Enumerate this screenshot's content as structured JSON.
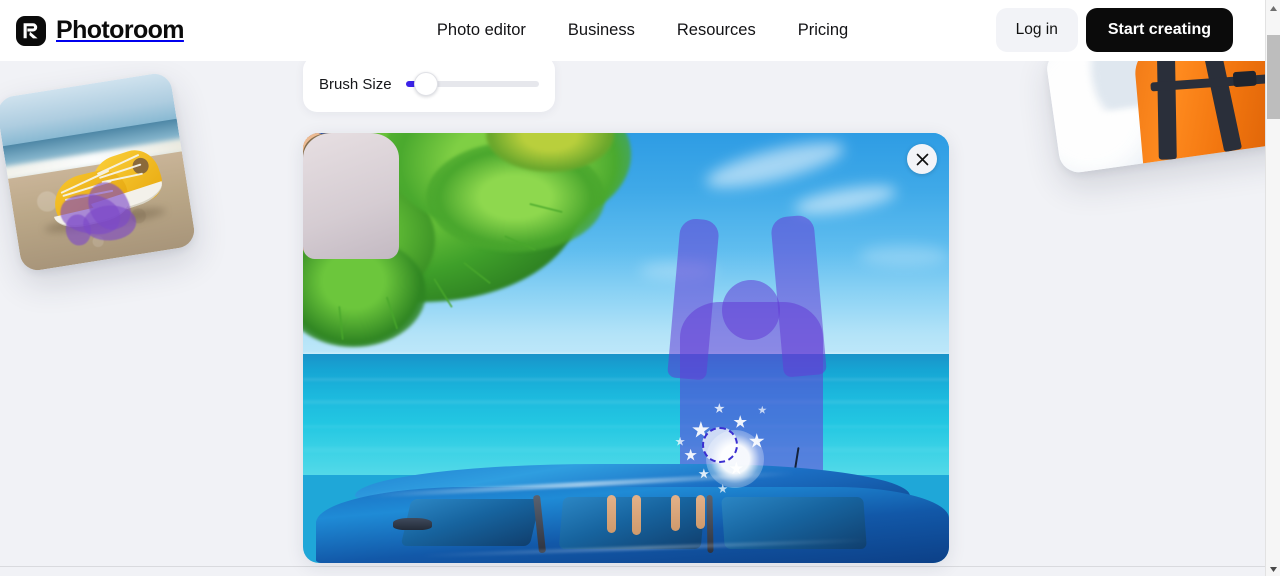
{
  "header": {
    "brand": "Photoroom",
    "logo_icon": "photoroom-r-logo-icon",
    "nav": [
      {
        "label": "Photo editor"
      },
      {
        "label": "Business"
      },
      {
        "label": "Resources"
      },
      {
        "label": "Pricing"
      }
    ],
    "login_label": "Log in",
    "start_label": "Start creating"
  },
  "toolbar": {
    "brush_size_label": "Brush Size",
    "brush_size_value": 8,
    "brush_size_min": 0,
    "brush_size_max": 100,
    "accent_color": "#3b22e8",
    "track_color": "#e6e7ec"
  },
  "editor": {
    "close_icon": "close-icon",
    "close_label": "Close",
    "brush_cursor_icon": "brush-cursor-circle-icon",
    "image_alt": "Family with raised arms sitting on the roof of a blue car by the sea",
    "mask_color": "#623cd6",
    "mask_subject": "man-right"
  },
  "decorations": {
    "left_card_alt": "Yellow sneakers on a beach with purple brush mask",
    "right_card_alt": "Person in orange jacket with backpack in the snow"
  },
  "scrollbar": {
    "up_icon": "caret-up-icon",
    "down_icon": "caret-down-icon",
    "thumb_label": "vertical-scroll-thumb"
  },
  "colors": {
    "page_background": "#f1f2f6",
    "header_background": "#ffffff",
    "text_primary": "#131316",
    "button_dark": "#0b0b0b",
    "button_light": "#f2f3f7"
  }
}
